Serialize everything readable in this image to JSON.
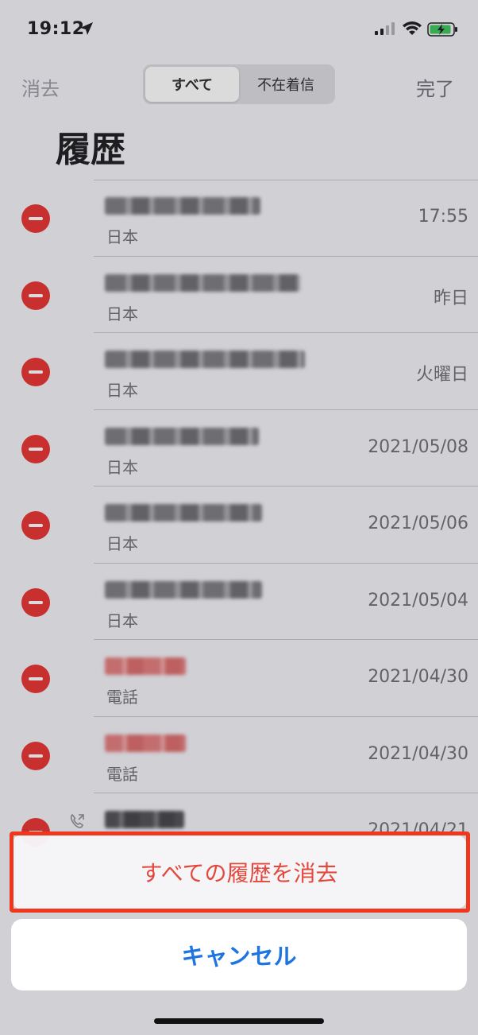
{
  "status_bar": {
    "time": "19:12",
    "icons": [
      "location-arrow-icon",
      "cellular-signal-icon",
      "wifi-icon",
      "battery-charging-icon"
    ]
  },
  "nav": {
    "clear_label": "消去",
    "done_label": "完了",
    "segments": [
      {
        "label": "すべて",
        "active": true
      },
      {
        "label": "不在着信",
        "active": false
      }
    ]
  },
  "page_title": "履歴",
  "calls": [
    {
      "subtitle": "日本",
      "date": "17:55",
      "name_color": "gray"
    },
    {
      "subtitle": "日本",
      "date": "昨日",
      "name_color": "gray"
    },
    {
      "subtitle": "日本",
      "date": "火曜日",
      "name_color": "gray"
    },
    {
      "subtitle": "日本",
      "date": "2021/05/08",
      "name_color": "gray"
    },
    {
      "subtitle": "日本",
      "date": "2021/05/06",
      "name_color": "gray"
    },
    {
      "subtitle": "日本",
      "date": "2021/05/04",
      "name_color": "gray"
    },
    {
      "subtitle": "電話",
      "date": "2021/04/30",
      "name_color": "red"
    },
    {
      "subtitle": "電話",
      "date": "2021/04/30",
      "name_color": "red"
    },
    {
      "subtitle": "",
      "date": "2021/04/21",
      "name_color": "dark"
    }
  ],
  "action_sheet": {
    "clear_all_label": "すべての履歴を消去",
    "cancel_label": "キャンセル"
  },
  "colors": {
    "delete_red": "#e8322f",
    "destructive_text": "#e3483d",
    "cancel_blue": "#1e74e0",
    "highlight_border": "#f0361d"
  }
}
